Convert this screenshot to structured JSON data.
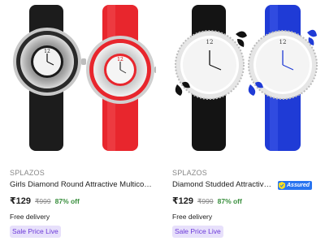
{
  "products": [
    {
      "brand": "SPLAZOS",
      "title": "Girls Diamond Round Attractive Multicolor Com...",
      "price": "₹129",
      "mrp": "₹999",
      "discount": "87% off",
      "delivery": "Free delivery",
      "badge": "Sale Price Live",
      "assured": false,
      "image_desc": "two-watches-black-and-red",
      "watch_colors": [
        "#1a1a1a",
        "#e8262d"
      ]
    },
    {
      "brand": "SPLAZOS",
      "title": "Diamond Studded Attractive Butte...",
      "price": "₹129",
      "mrp": "₹999",
      "discount": "87% off",
      "delivery": "Free delivery",
      "badge": "Sale Price Live",
      "assured": true,
      "assured_label": "Assured",
      "image_desc": "two-butterfly-watches-black-and-blue",
      "watch_colors": [
        "#111111",
        "#1f3bd6"
      ]
    }
  ],
  "colors": {
    "price_discount": "#388e3c",
    "assured_blue": "#2874f0",
    "badge_bg": "#e7e0fb",
    "badge_text": "#6c3ad8"
  }
}
